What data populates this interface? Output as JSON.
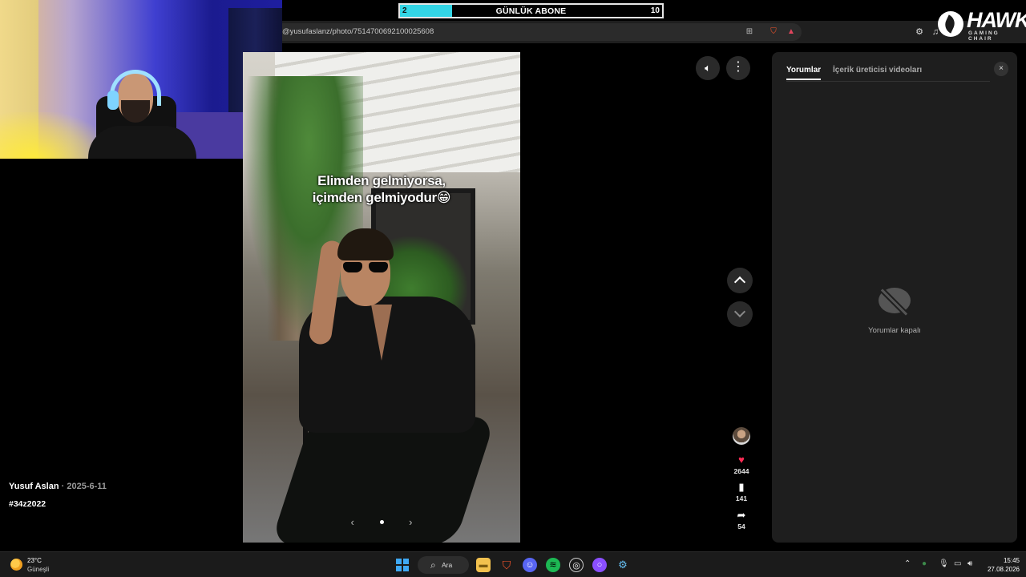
{
  "goal": {
    "label": "GÜNLÜK ABONE",
    "current": "2",
    "target": "10",
    "progress": 0.2,
    "fill_color": "#33d6e6"
  },
  "logo": {
    "name": "HAWK",
    "sub": "GAMING CHAIR"
  },
  "browser": {
    "url": "@yusufaslanz/photo/7514700692100025608"
  },
  "video": {
    "caption_line1": "Elimden gelmiyorsa,",
    "caption_line2": "içimden gelmiyodur😁",
    "prev_label": "‹",
    "next_label": "›"
  },
  "post": {
    "author": "Yusuf Aslan",
    "separator": " · ",
    "date": "2025-6-11",
    "hashtag": "#34z2022"
  },
  "actions": {
    "likes": "2644",
    "saves": "141",
    "shares": "54"
  },
  "panel": {
    "tab_comments": "Yorumlar",
    "tab_creator": "İçerik üreticisi videoları",
    "comments_off": "Yorumlar kapalı",
    "close": "×"
  },
  "taskbar": {
    "weather_temp": "23°C",
    "weather_desc": "Güneşli",
    "search": "Ara",
    "time": "15:45",
    "date": "27.08.2026"
  },
  "colors": {
    "like": "#fe2c55",
    "accent": "#33d6e6"
  }
}
